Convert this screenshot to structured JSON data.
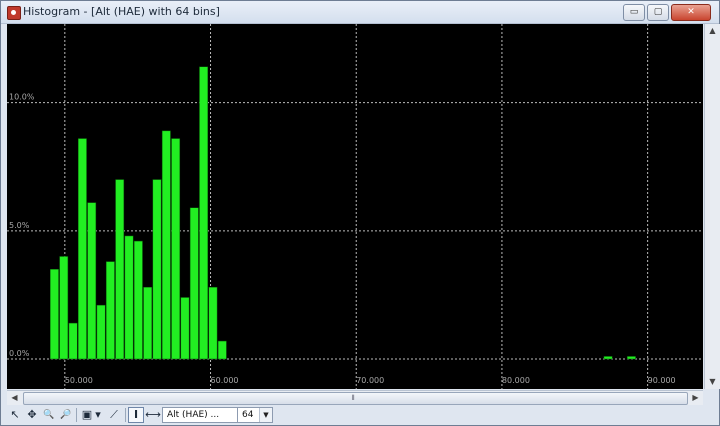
{
  "window": {
    "title": "Histogram - [Alt (HAE) with 64 bins]",
    "buttons": {
      "minimize": "▭",
      "maximize": "▢",
      "close": "✕"
    }
  },
  "chart_data": {
    "type": "bar",
    "title": "",
    "xlabel": "",
    "ylabel": "",
    "y_format": "percent",
    "x_ticks": [
      "50.000",
      "60.000",
      "70.000",
      "80.000",
      "90.000"
    ],
    "x_tick_values": [
      50,
      60,
      70,
      80,
      90
    ],
    "y_ticks": [
      "0.0%",
      "5.0%",
      "10.0%"
    ],
    "y_tick_values": [
      0,
      5,
      10
    ],
    "xlim": [
      49.6,
      93.8
    ],
    "ylim": [
      0,
      12.6
    ],
    "bin_width": 0.64,
    "grid": true,
    "bar_color": "#22ee22",
    "grid_color": "#bbbbbb",
    "bins": [
      {
        "x": 49.0,
        "value": 3.5
      },
      {
        "x": 49.64,
        "value": 4.0
      },
      {
        "x": 50.28,
        "value": 1.4
      },
      {
        "x": 50.92,
        "value": 8.6
      },
      {
        "x": 51.56,
        "value": 6.1
      },
      {
        "x": 52.2,
        "value": 2.1
      },
      {
        "x": 52.84,
        "value": 3.8
      },
      {
        "x": 53.48,
        "value": 7.0
      },
      {
        "x": 54.12,
        "value": 4.8
      },
      {
        "x": 54.76,
        "value": 4.6
      },
      {
        "x": 55.4,
        "value": 2.8
      },
      {
        "x": 56.04,
        "value": 7.0
      },
      {
        "x": 56.68,
        "value": 8.9
      },
      {
        "x": 57.32,
        "value": 8.6
      },
      {
        "x": 57.96,
        "value": 2.4
      },
      {
        "x": 58.6,
        "value": 5.9
      },
      {
        "x": 59.24,
        "value": 11.4
      },
      {
        "x": 59.88,
        "value": 2.8
      },
      {
        "x": 60.52,
        "value": 0.7
      },
      {
        "x": 87.0,
        "value": 0.1
      },
      {
        "x": 88.6,
        "value": 0.1
      }
    ]
  },
  "scrollbars": {
    "h_left": "◀",
    "h_right": "▶",
    "h_grip": "⦀",
    "v_up": "▲",
    "v_down": "▼"
  },
  "toolbar": {
    "select_icon": "↖",
    "pan_icon": "✥",
    "zoom_in_icon": "🔍",
    "zoom_out_icon": "🔎",
    "copy_icon": "▣",
    "copy_dropdown_icon": "▾",
    "axes_icon": "⟋",
    "vertical_measure_icon": "I",
    "horizontal_measure_icon": "⟷",
    "field_value": "Alt (HAE) ...",
    "bins_value": "64",
    "bins_dropdown_icon": "▼"
  }
}
